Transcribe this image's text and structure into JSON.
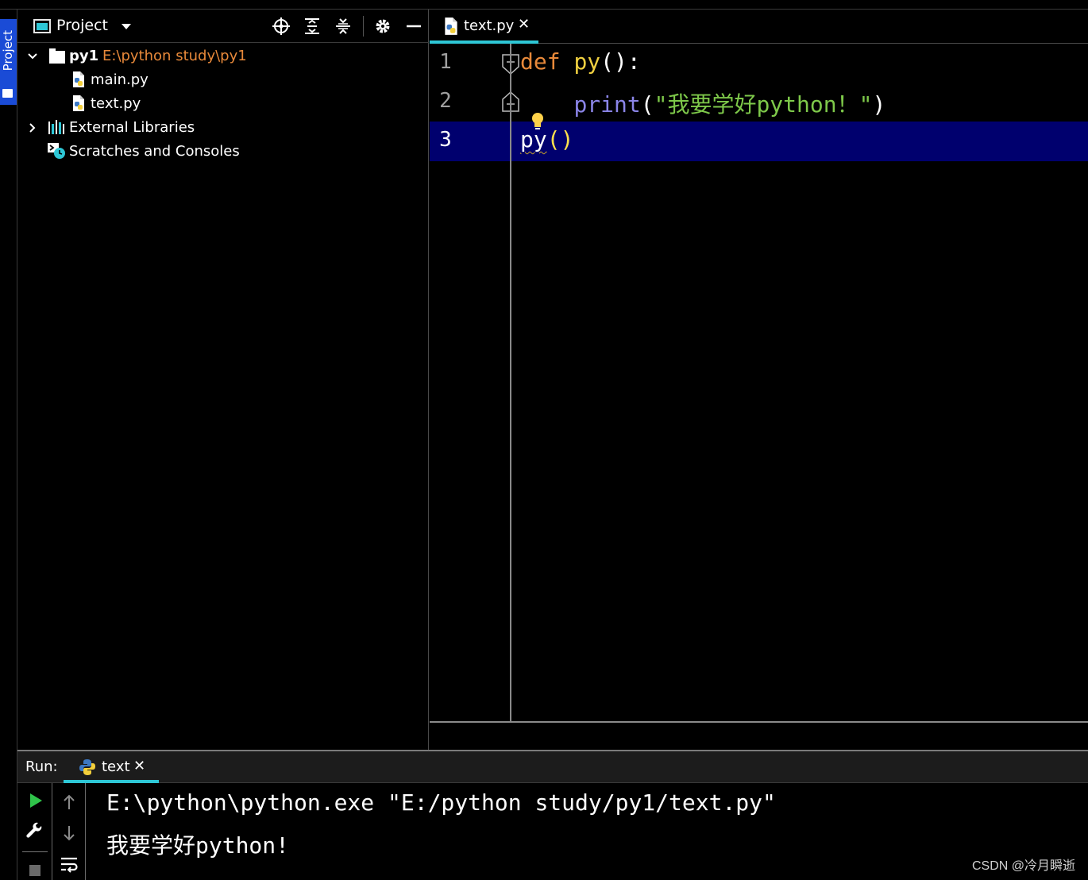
{
  "sidebar": {
    "project_tab_label": "Project"
  },
  "project_panel": {
    "title": "Project",
    "tree": {
      "root_name": "py1",
      "root_path": "E:\\python study\\py1",
      "files": [
        "main.py",
        "text.py"
      ],
      "external_libraries": "External Libraries",
      "scratches": "Scratches and Consoles"
    }
  },
  "editor": {
    "tab_label": "text.py",
    "tab_close": "✕",
    "line_numbers": [
      "1",
      "2",
      "3"
    ],
    "current_line": 3,
    "code": {
      "line1": {
        "kw": "def",
        "fn": "py",
        "rest": "():"
      },
      "line2": {
        "builtin": "print",
        "open": "(",
        "string": "\"我要学好python！\"",
        "close": ")"
      },
      "line3": {
        "name": "py",
        "parens": "()"
      }
    }
  },
  "run_panel": {
    "label": "Run:",
    "tab_label": "text",
    "tab_close": "✕",
    "output": [
      "E:\\python\\python.exe \"E:/python study/py1/text.py\"",
      "我要学好python!"
    ]
  },
  "watermark": "CSDN @冷月瞬逝",
  "colors": {
    "accent": "#2ec7d6",
    "keyword": "#e8893a",
    "function": "#f0d040",
    "builtin": "#8b85e8",
    "string": "#7ec94a",
    "current_line_bg": "#00006e",
    "project_tab_bg": "#1a4bd6",
    "path_text": "#e8893a"
  }
}
